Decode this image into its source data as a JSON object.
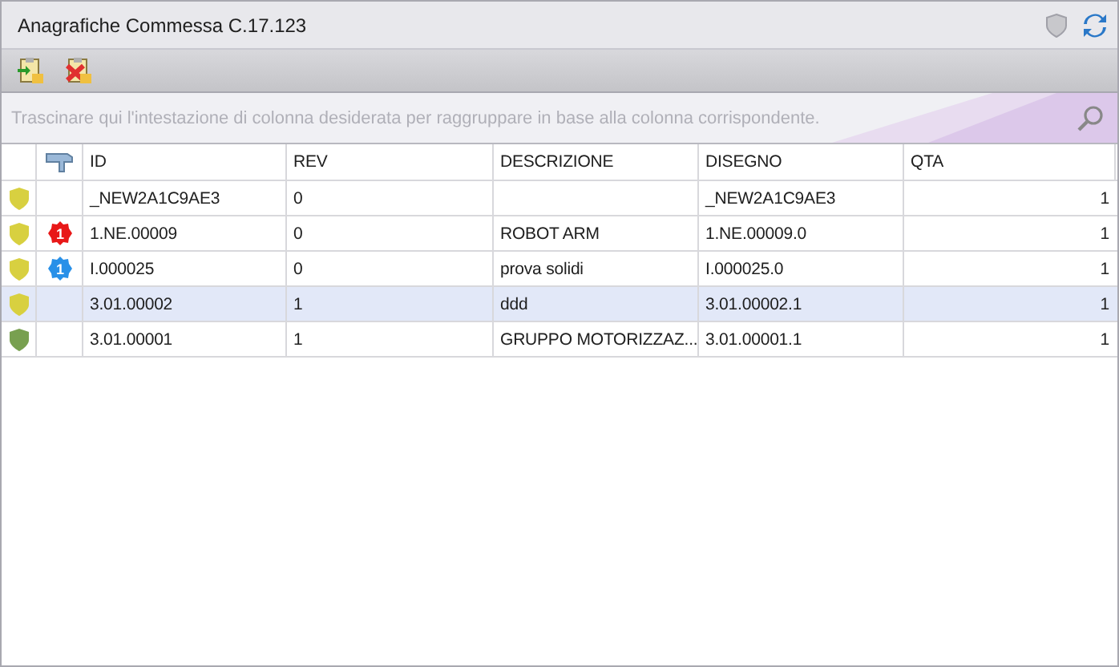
{
  "window": {
    "title": "Anagrafiche Commessa C.17.123"
  },
  "group_panel": {
    "placeholder": "Trascinare qui l'intestazione di colonna desiderata per raggruppare in base alla colonna corrispondente."
  },
  "table": {
    "columns": [
      "ID",
      "REV",
      "DESCRIZIONE",
      "DISEGNO",
      "QTA"
    ],
    "rows": [
      {
        "color": "#d8d040",
        "badge": null,
        "selected": false,
        "cells": [
          "_NEW2A1C9AE3",
          "0",
          "",
          "_NEW2A1C9AE3",
          "1"
        ]
      },
      {
        "color": "#d8d040",
        "badge": {
          "text": "1",
          "color": "#e81818"
        },
        "selected": false,
        "cells": [
          "1.NE.00009",
          "0",
          "ROBOT ARM",
          "1.NE.00009.0",
          "1"
        ]
      },
      {
        "color": "#d8d040",
        "badge": {
          "text": "1",
          "color": "#2890e8"
        },
        "selected": false,
        "cells": [
          "I.000025",
          "0",
          "prova solidi",
          "I.000025.0",
          "1"
        ]
      },
      {
        "color": "#d8d040",
        "badge": null,
        "selected": true,
        "cells": [
          "3.01.00002",
          "1",
          "ddd",
          "3.01.00002.1",
          "1"
        ]
      },
      {
        "color": "#78a050",
        "badge": null,
        "selected": false,
        "cells": [
          "3.01.00001",
          "1",
          "GRUPPO MOTORIZZAZ...",
          "3.01.00001.1",
          "1"
        ]
      }
    ]
  }
}
